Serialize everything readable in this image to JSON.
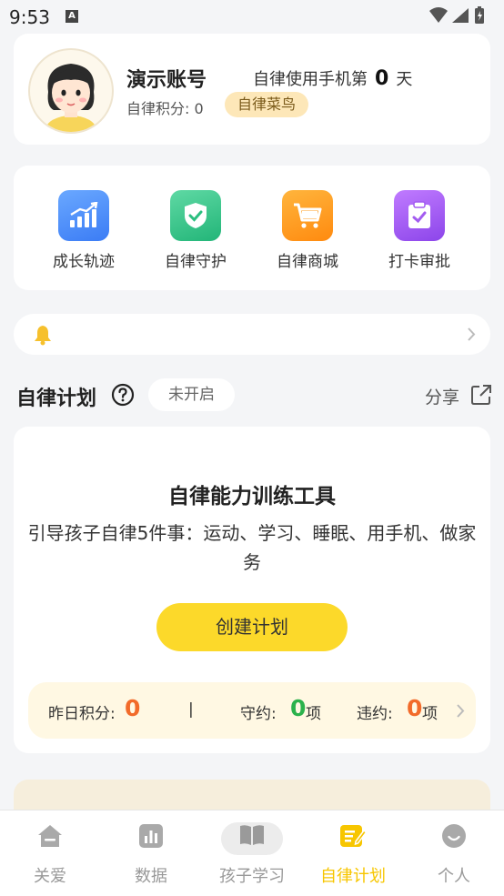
{
  "status_bar": {
    "time": "9:53",
    "notif_glyph": "A"
  },
  "profile": {
    "name": "演示账号",
    "days_prefix": "自律使用手机第",
    "days": "0",
    "days_suffix": "天",
    "points_text": "自律积分: 0",
    "rank_badge": "自律菜鸟"
  },
  "grid": [
    {
      "label": "成长轨迹",
      "icon": "growth-chart-icon",
      "color": "#4a8dff"
    },
    {
      "label": "自律守护",
      "icon": "shield-check-icon",
      "color": "#34c48a"
    },
    {
      "label": "自律商城",
      "icon": "shopping-cart-icon",
      "color": "#ff9a1f"
    },
    {
      "label": "打卡审批",
      "icon": "clipboard-check-icon",
      "color": "#a35cf0"
    }
  ],
  "notice": {
    "icon": "bell-icon"
  },
  "plan_section": {
    "title": "自律计划",
    "status": "未开启",
    "share_label": "分享"
  },
  "plan_card": {
    "title": "自律能力训练工具",
    "description": "引导孩子自律5件事：运动、学习、睡眠、用手机、做家务",
    "create_button": "创建计划",
    "stats": {
      "yesterday_label": "昨日积分:",
      "yesterday_value": "0",
      "separator": "|",
      "kept_label": "守约:",
      "kept_value": "0",
      "kept_unit": "项",
      "broken_label": "违约:",
      "broken_value": "0",
      "broken_unit": "项"
    }
  },
  "bottom_nav": [
    {
      "label": "关爱",
      "icon": "home-icon"
    },
    {
      "label": "数据",
      "icon": "bar-chart-icon"
    },
    {
      "label": "孩子学习",
      "icon": "book-icon"
    },
    {
      "label": "自律计划",
      "icon": "plan-edit-icon",
      "active": true
    },
    {
      "label": "个人",
      "icon": "person-icon"
    }
  ],
  "colors": {
    "accent": "#fcd92a",
    "active_nav": "#f7c600",
    "orange": "#f26b2a",
    "green": "#2bb24c"
  }
}
